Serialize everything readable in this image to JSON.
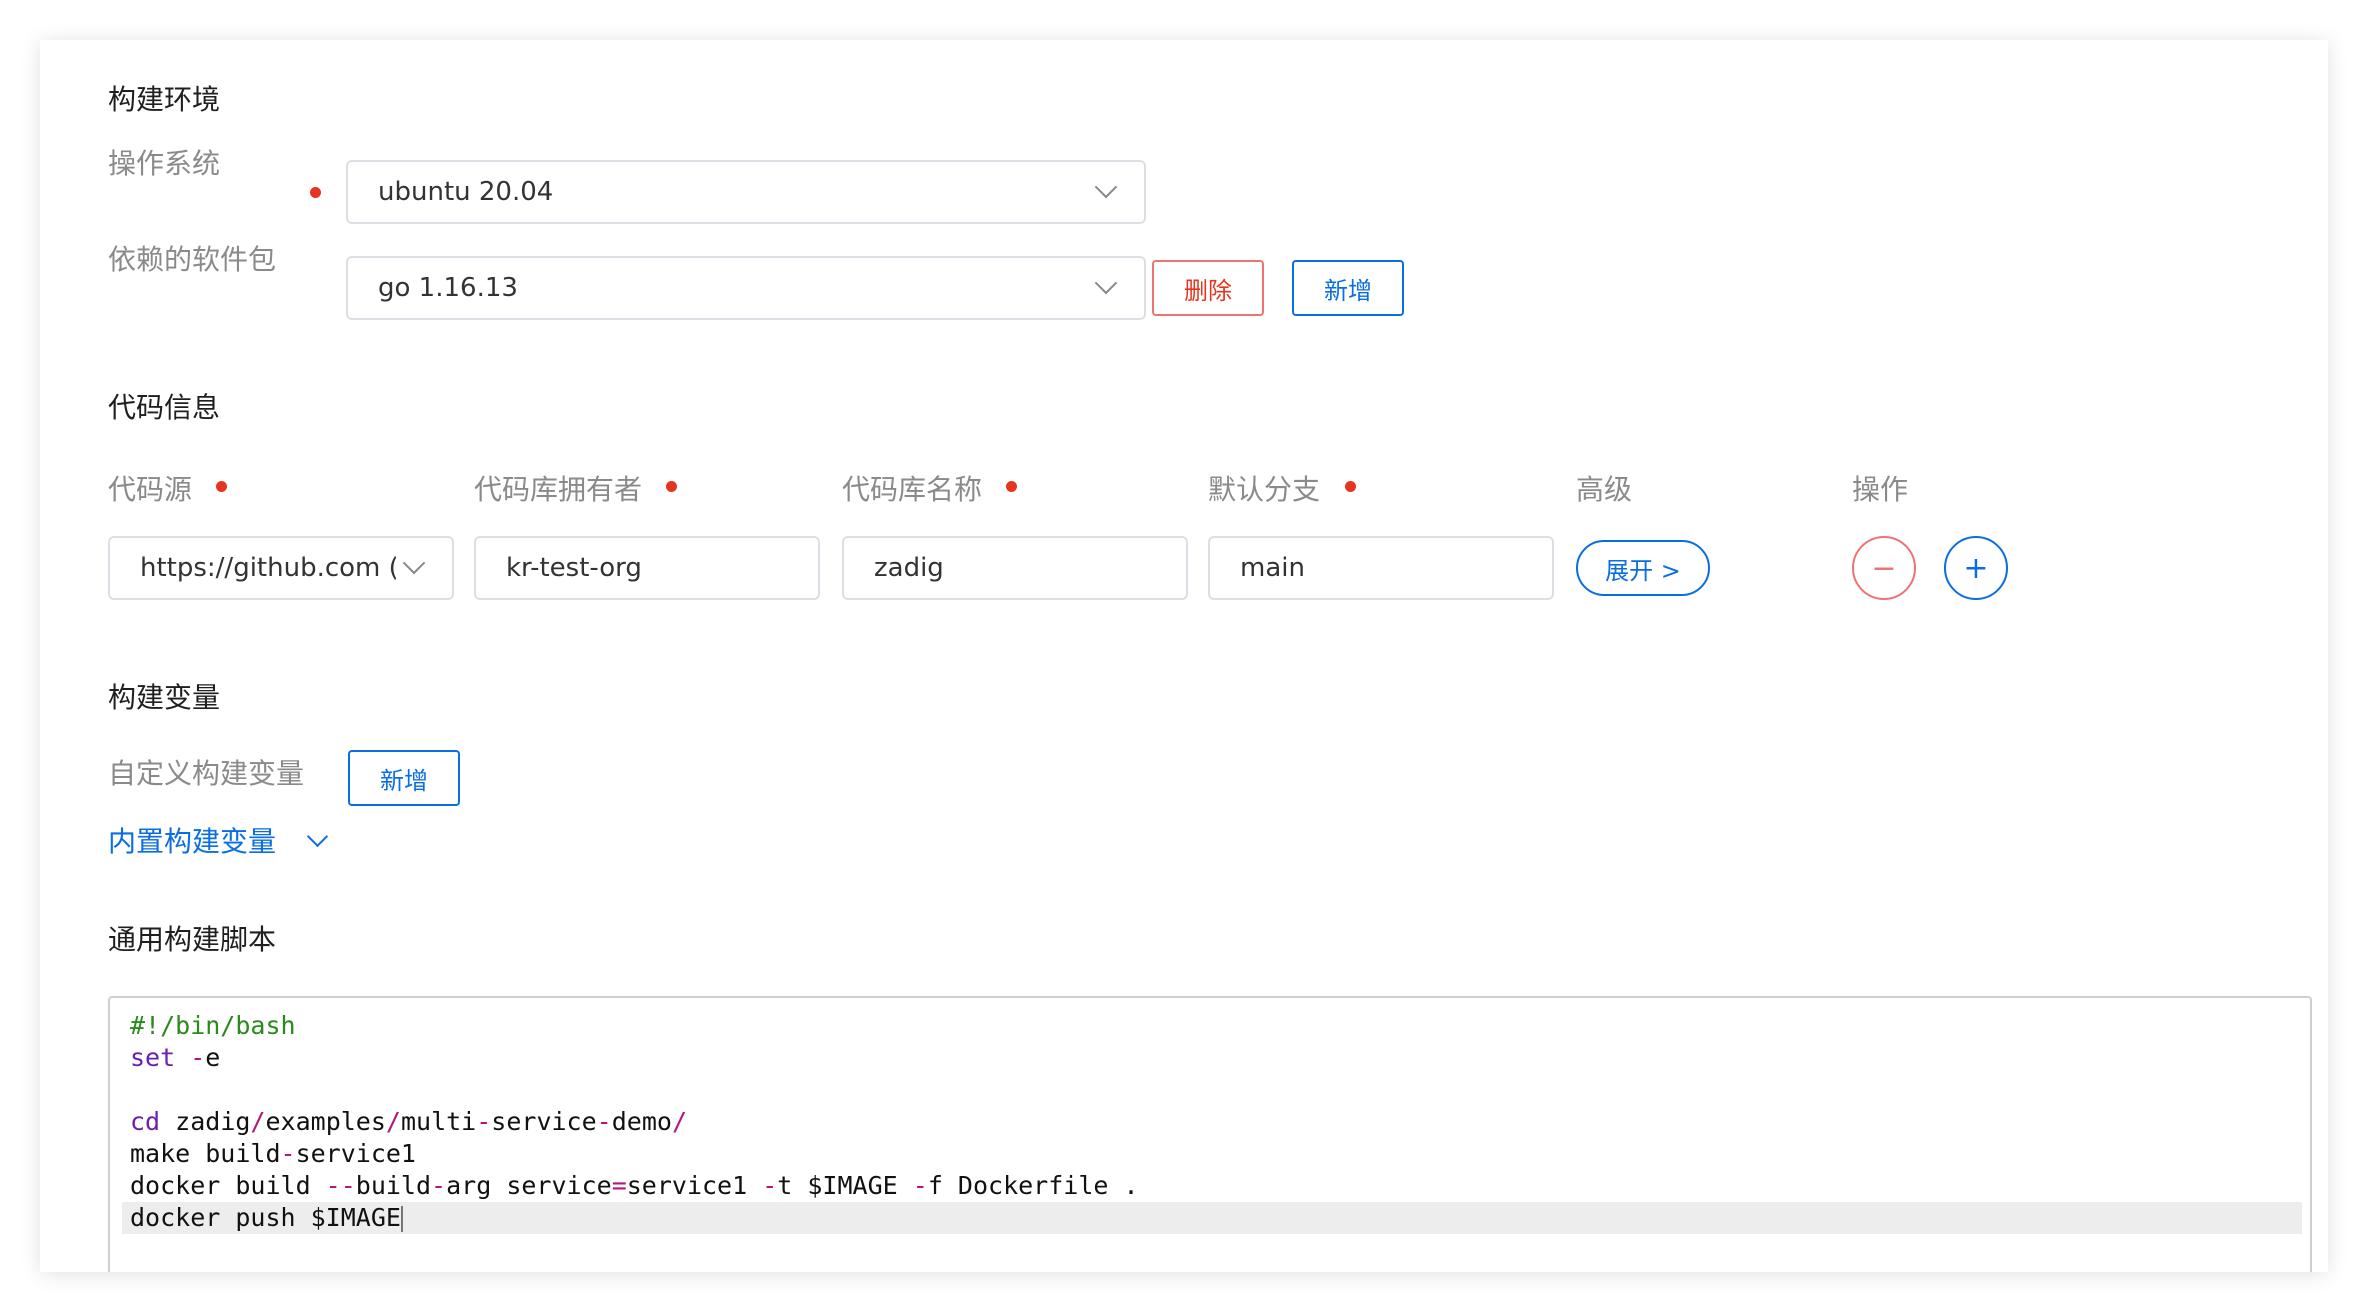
{
  "build_env": {
    "title": "构建环境",
    "os_label": "操作系统",
    "os_value": "ubuntu 20.04",
    "deps_label": "依赖的软件包",
    "deps_value": "go 1.16.13",
    "delete_label": "删除",
    "add_label": "新增"
  },
  "code_info": {
    "title": "代码信息",
    "headers": {
      "source": "代码源",
      "owner": "代码库拥有者",
      "repo": "代码库名称",
      "branch": "默认分支",
      "advanced": "高级",
      "action": "操作"
    },
    "row": {
      "source": "https://github.com (kr",
      "owner": "kr-test-org",
      "repo": "zadig",
      "branch": "main",
      "expand_label": "展开 >"
    },
    "remove_icon": "−",
    "add_icon": "+"
  },
  "build_vars": {
    "title": "构建变量",
    "custom_label": "自定义构建变量",
    "add_label": "新增",
    "builtin_label": "内置构建变量"
  },
  "script": {
    "title": "通用构建脚本",
    "lines": [
      "#!/bin/bash",
      "set -e",
      "",
      "cd zadig/examples/multi-service-demo/",
      "make build-service1",
      "docker build --build-arg service=service1 -t $IMAGE -f Dockerfile .",
      "docker push $IMAGE"
    ]
  },
  "colors": {
    "required_dot": "#e5341f",
    "primary": "#0a6ee2",
    "danger": "#e5341f"
  }
}
